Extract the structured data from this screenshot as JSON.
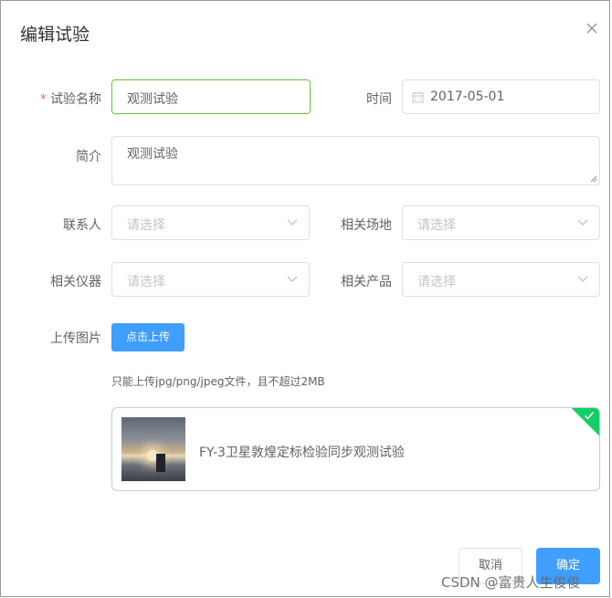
{
  "dialog": {
    "title": "编辑试验",
    "close_icon": "close-icon"
  },
  "form": {
    "name_label": "试验名称",
    "name_required_mark": "*",
    "name_value": "观测试验",
    "time_label": "时间",
    "time_icon": "calendar-icon",
    "time_value": "2017-05-01",
    "intro_label": "简介",
    "intro_value": "观测试验",
    "contact_label": "联系人",
    "contact_placeholder": "请选择",
    "site_label": "相关场地",
    "site_placeholder": "请选择",
    "instrument_label": "相关仪器",
    "instrument_placeholder": "请选择",
    "product_label": "相关产品",
    "product_placeholder": "请选择",
    "upload_label": "上传图片",
    "upload_button": "点击上传",
    "upload_tip": "只能上传jpg/png/jpeg文件，且不超过2MB",
    "file_name": "FY-3卫星敦煌定标检验同步观测试验",
    "file_status_icon": "check-icon",
    "file_status_color": "#13ce66"
  },
  "footer": {
    "cancel_label": "取消",
    "confirm_label": "确定"
  },
  "watermark": "CSDN @富贵人生俊俊",
  "colors": {
    "primary": "#409eff",
    "success": "#13ce66",
    "focus_border": "#67c23a",
    "required": "#f56c6c"
  }
}
